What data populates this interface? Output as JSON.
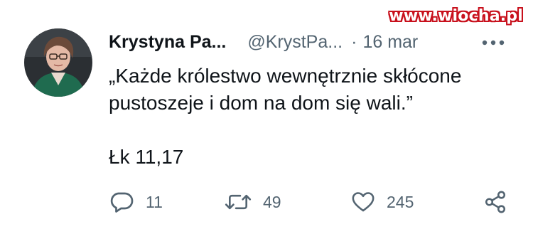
{
  "watermark": "www.wiocha.pl",
  "tweet": {
    "author_name": "Krystyna Pa...",
    "handle": "@KrystPa...",
    "separator": "·",
    "date": "16 mar",
    "text_line1": "„Każde królestwo wewnętrznie skłócone",
    "text_line2": "pustoszeje i dom na dom się wali.”",
    "reference": "Łk 11,17"
  },
  "actions": {
    "replies": "11",
    "reposts": "49",
    "likes": "245"
  },
  "icons": {
    "more": "more-dots-icon",
    "reply": "reply-bubble-icon",
    "repost": "repost-arrows-icon",
    "like": "heart-icon",
    "share": "share-icon"
  },
  "colors": {
    "text": "#0f1419",
    "secondary": "#536471",
    "watermark_outline": "#c8101c"
  }
}
